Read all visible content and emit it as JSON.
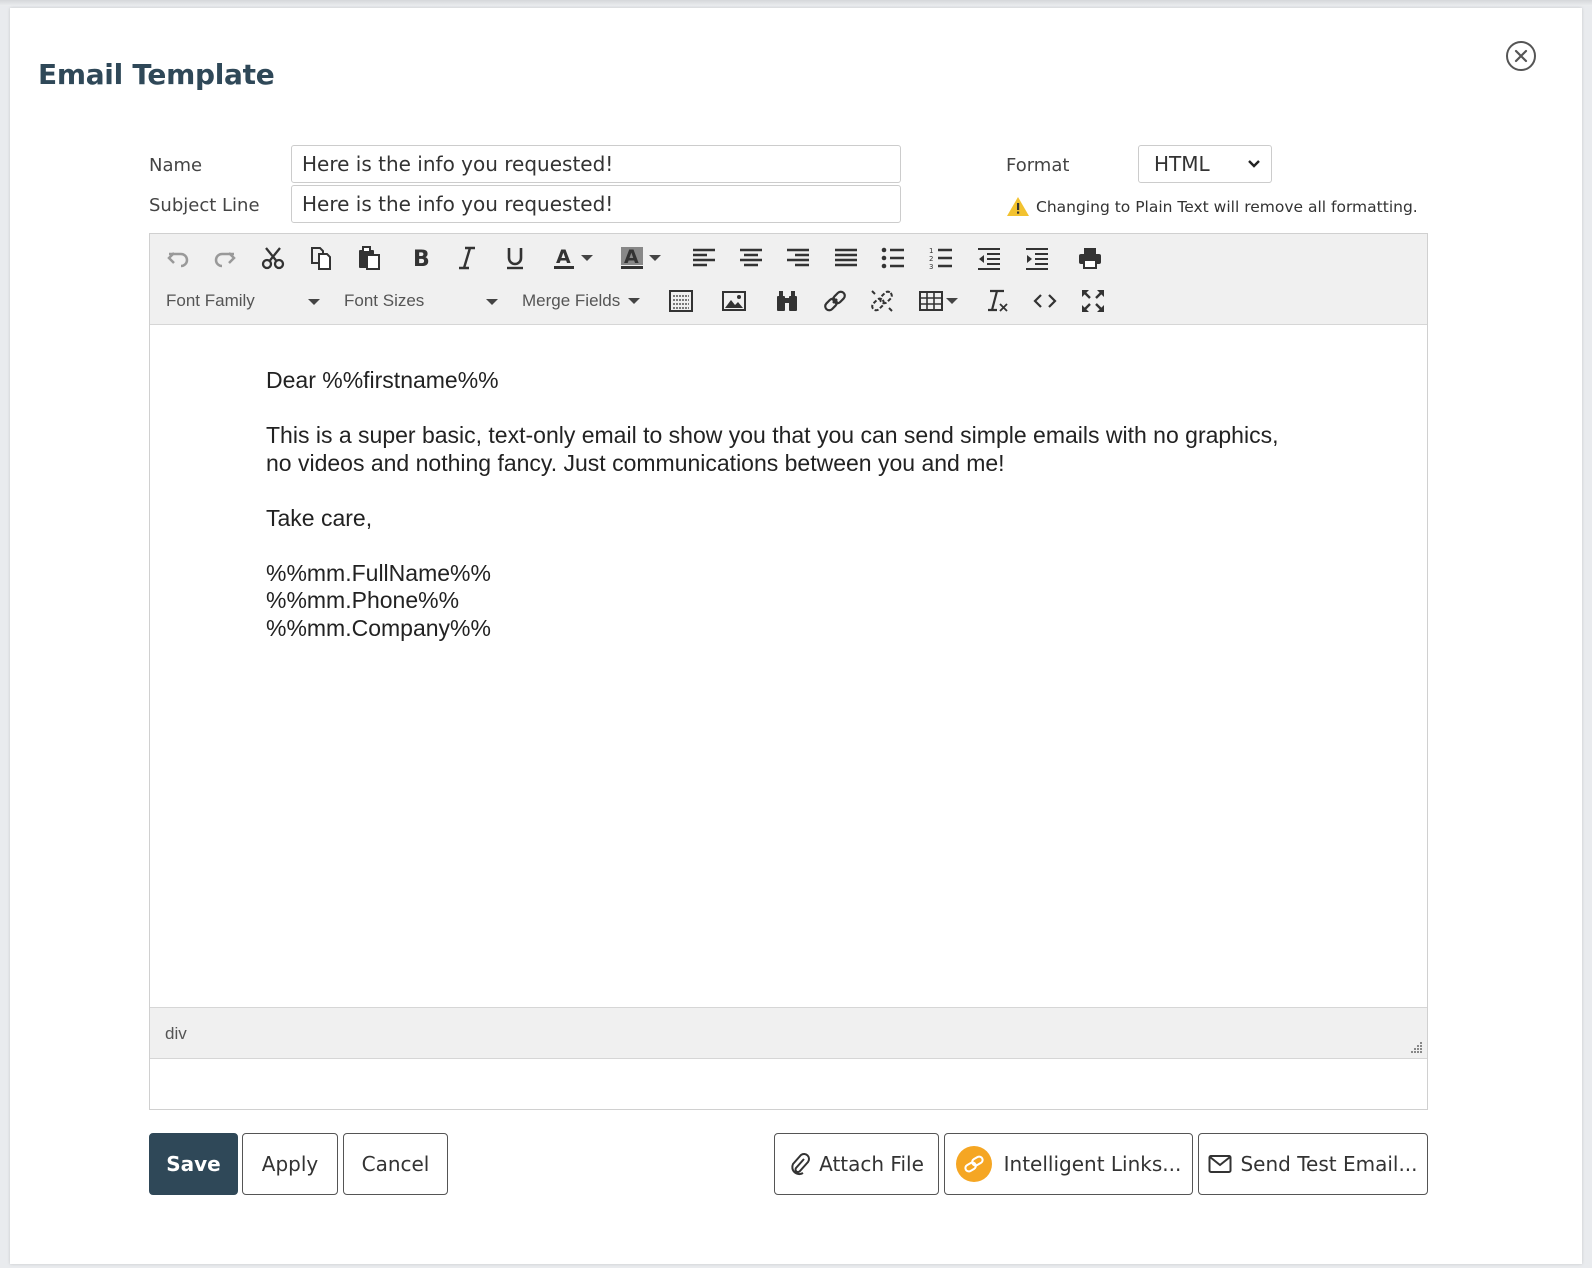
{
  "dialog": {
    "title": "Email Template"
  },
  "form": {
    "name_label": "Name",
    "name_value": "Here is the info you requested!",
    "subject_label": "Subject Line",
    "subject_value": "Here is the info you requested!",
    "format_label": "Format",
    "format_value": "HTML",
    "format_warning": "Changing to Plain Text will remove all formatting."
  },
  "toolbar": {
    "font_family": "Font Family",
    "font_sizes": "Font Sizes",
    "merge_fields": "Merge Fields",
    "icons_row1": [
      "undo-icon",
      "redo-icon",
      "cut-icon",
      "copy-icon",
      "paste-icon",
      "bold-icon",
      "italic-icon",
      "underline-icon",
      "font-color-icon",
      "highlight-color-icon",
      "align-left-icon",
      "align-center-icon",
      "align-right-icon",
      "justify-icon",
      "bulleted-list-icon",
      "numbered-list-icon",
      "outdent-icon",
      "indent-icon",
      "print-icon"
    ],
    "icons_row2": [
      "template-icon",
      "image-icon",
      "find-icon",
      "link-icon",
      "unlink-icon",
      "table-icon",
      "clear-formatting-icon",
      "source-code-icon",
      "fullscreen-icon"
    ]
  },
  "editor": {
    "lines": {
      "greeting": "Dear %%firstname%%",
      "body_1": "This is a super basic, text-only email to show you that you can send simple emails with no graphics,",
      "body_2": "no videos and nothing fancy. Just communications between you and me!",
      "closing": "Take care,",
      "sig_1": "%%mm.FullName%%",
      "sig_2": "%%mm.Phone%%",
      "sig_3": "%%mm.Company%%"
    },
    "status_path": "div"
  },
  "actions": {
    "save": "Save",
    "apply": "Apply",
    "cancel": "Cancel",
    "attach_file": "Attach File",
    "intelligent_links": "Intelligent Links...",
    "send_test_email": "Send Test Email..."
  },
  "colors": {
    "primary": "#2f4858",
    "intelligent_links_icon": "#f5a623",
    "warning": "#f2c230"
  }
}
